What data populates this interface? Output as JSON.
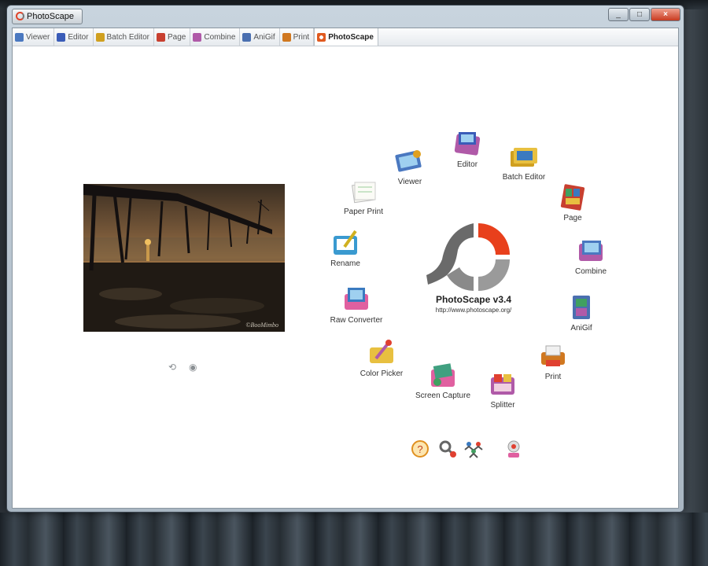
{
  "window": {
    "title": "PhotoScape"
  },
  "tabs": [
    {
      "label": "Viewer",
      "color": "#4a78c0"
    },
    {
      "label": "Editor",
      "color": "#3a5cb8"
    },
    {
      "label": "Batch Editor",
      "color": "#d0a020"
    },
    {
      "label": "Page",
      "color": "#c84030"
    },
    {
      "label": "Combine",
      "color": "#b05aa8"
    },
    {
      "label": "AniGif",
      "color": "#4a6fb0"
    },
    {
      "label": "Print",
      "color": "#d07820"
    },
    {
      "label": "PhotoScape",
      "color": "#e05a20"
    }
  ],
  "active_tab": "PhotoScape",
  "photo": {
    "credit": "©BooMimbo"
  },
  "photo_controls": {
    "prev_icon": "refresh-icon",
    "next_icon": "eye-icon"
  },
  "launcher": {
    "items": [
      {
        "label": "Viewer",
        "icon": "viewer-icon"
      },
      {
        "label": "Editor",
        "icon": "editor-icon"
      },
      {
        "label": "Batch Editor",
        "icon": "batch-editor-icon"
      },
      {
        "label": "Page",
        "icon": "page-icon"
      },
      {
        "label": "Combine",
        "icon": "combine-icon"
      },
      {
        "label": "AniGif",
        "icon": "anigif-icon"
      },
      {
        "label": "Print",
        "icon": "print-icon"
      },
      {
        "label": "Splitter",
        "icon": "splitter-icon"
      },
      {
        "label": "Screen Capture",
        "icon": "screen-capture-icon"
      },
      {
        "label": "Color Picker",
        "icon": "color-picker-icon"
      },
      {
        "label": "Raw Converter",
        "icon": "raw-converter-icon"
      },
      {
        "label": "Rename",
        "icon": "rename-icon"
      },
      {
        "label": "Paper Print",
        "icon": "paper-print-icon"
      }
    ]
  },
  "logo": {
    "title": "PhotoScape v3.4",
    "url": "http://www.photoscape.org/",
    "accent": "#e8401c"
  },
  "bottom_icons": [
    "help-icon",
    "tools-icon",
    "people-icon",
    "update-icon"
  ]
}
